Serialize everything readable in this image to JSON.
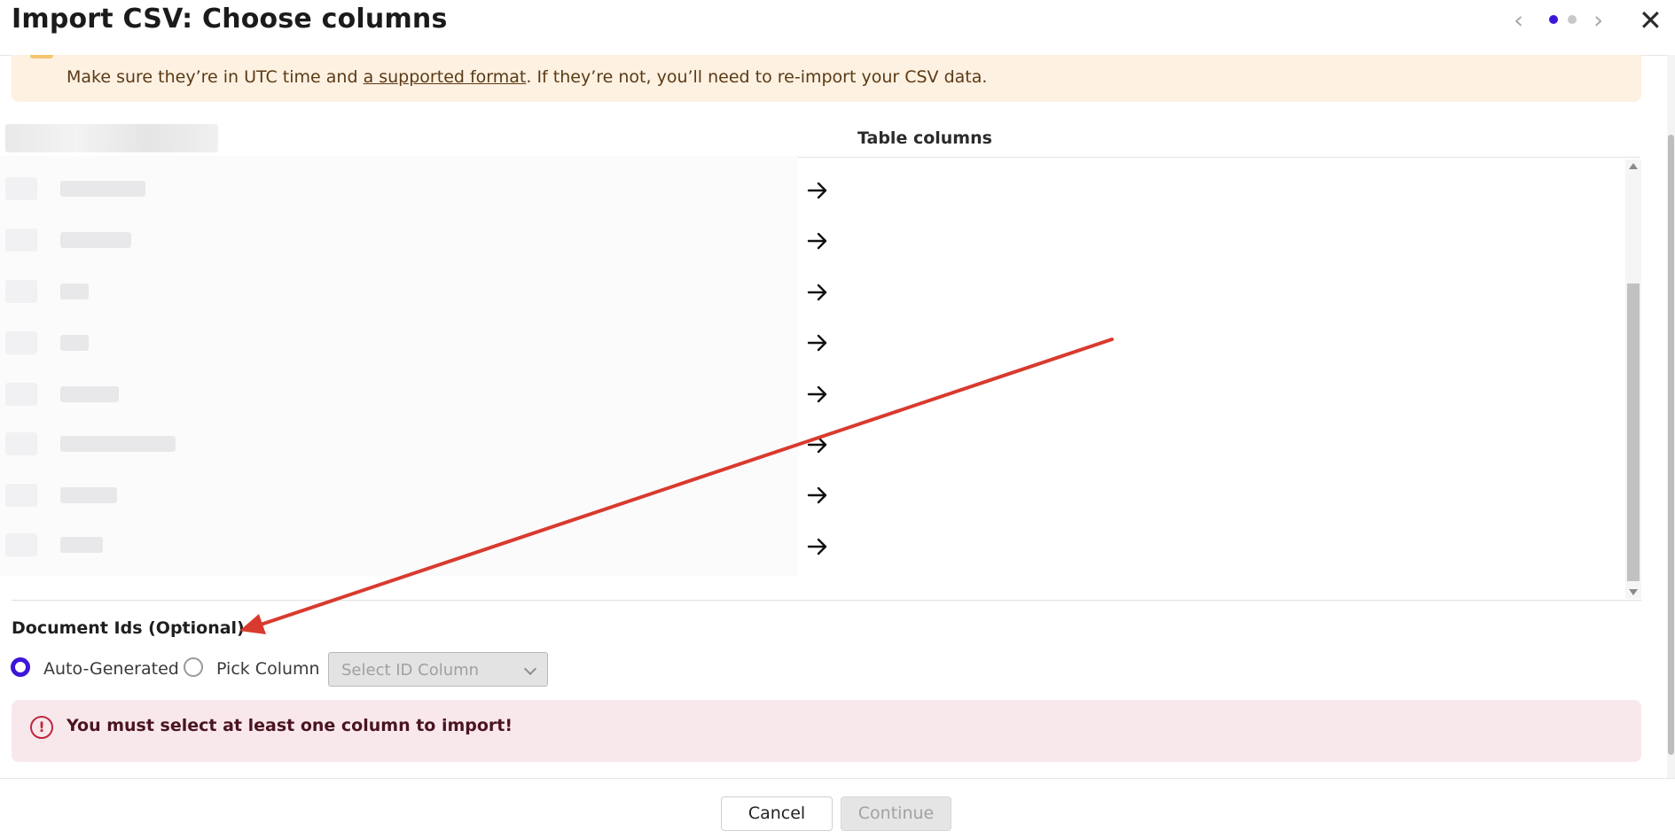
{
  "header": {
    "title": "Import CSV: Choose columns",
    "prev_icon": "chevron-left-icon",
    "next_icon": "chevron-right-icon",
    "close_icon": "close-icon",
    "steps": {
      "current": 1,
      "total": 2
    }
  },
  "warning": {
    "text_before": "Make sure they’re in UTC time and ",
    "link": "a supported format",
    "text_after": ". If they’re not, you’ll need to re-import your CSV data.",
    "color": "#fdf1e2"
  },
  "mapping": {
    "table_columns_label": "Table columns",
    "row_count": 8,
    "arrow_icon": "arrow-right-icon"
  },
  "document_ids": {
    "label": "Document Ids (Optional)",
    "options": [
      {
        "label": "Auto-Generated",
        "selected": true
      },
      {
        "label": "Pick Column",
        "selected": false
      }
    ],
    "select_placeholder": "Select ID Column"
  },
  "error": {
    "icon": "alert-circle-icon",
    "message": "You must select at least one column to import!",
    "color": "#f9e8eb"
  },
  "footer": {
    "cancel_label": "Cancel",
    "continue_label": "Continue"
  },
  "colors": {
    "accent": "#3d16d8",
    "annotation_arrow": "#d93a2e"
  }
}
